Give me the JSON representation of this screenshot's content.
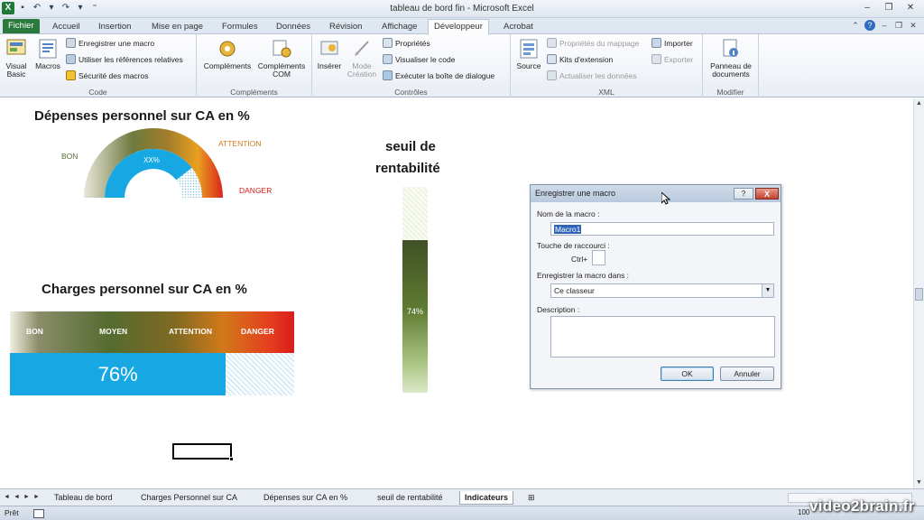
{
  "app": {
    "title": "tableau de bord fin  -  Microsoft Excel"
  },
  "ribbon_tabs": [
    {
      "label": "Fichier",
      "state": "file"
    },
    {
      "label": "Accueil",
      "state": ""
    },
    {
      "label": "Insertion",
      "state": ""
    },
    {
      "label": "Mise en page",
      "state": ""
    },
    {
      "label": "Formules",
      "state": ""
    },
    {
      "label": "Données",
      "state": ""
    },
    {
      "label": "Révision",
      "state": ""
    },
    {
      "label": "Affichage",
      "state": ""
    },
    {
      "label": "Développeur",
      "state": "active"
    },
    {
      "label": "Acrobat",
      "state": ""
    }
  ],
  "ribbon": {
    "code": {
      "group_label": "Code",
      "visual_basic": "Visual Basic",
      "macros": "Macros",
      "record_macro": "Enregistrer une macro",
      "relative_refs": "Utiliser les références relatives",
      "macro_security": "Sécurité des macros"
    },
    "addins": {
      "group_label": "Compléments",
      "addins": "Compléments",
      "com_addins": "Compléments COM"
    },
    "controls": {
      "group_label": "Contrôles",
      "insert": "Insérer",
      "design_mode": "Mode Création",
      "properties": "Propriétés",
      "view_code": "Visualiser le code",
      "run_dialog": "Exécuter la boîte de dialogue"
    },
    "xml": {
      "group_label": "XML",
      "source": "Source",
      "map_properties": "Propriétés du mappage",
      "expansion_packs": "Kits d'extension",
      "refresh_data": "Actualiser les données",
      "import": "Importer",
      "export": "Exporter"
    },
    "modify": {
      "group_label": "Modifier",
      "document_panel": "Panneau de documents"
    }
  },
  "gauge_semicircle": {
    "title": "Dépenses personnel sur CA en %",
    "value_label": "XX%",
    "labels": {
      "good": "BON",
      "attention": "ATTENTION",
      "danger": "DANGER"
    },
    "fill_fraction": 0.79
  },
  "gauge_horizontal": {
    "title": "Charges personnel sur CA en %",
    "labels": [
      "BON",
      "MOYEN",
      "ATTENTION",
      "DANGER"
    ],
    "value_label": "76%",
    "value": 0.76
  },
  "gauge_vertical": {
    "title_line1": "seuil de",
    "title_line2": "rentabilité",
    "value_label": "74%",
    "value": 0.74
  },
  "dialog": {
    "title": "Enregistrer une macro",
    "help_btn": "?",
    "close_btn": "X",
    "name_label": "Nom de la macro :",
    "name_value": "Macro1",
    "shortcut_label": "Touche de raccourci :",
    "ctrl_label": "Ctrl+",
    "store_label": "Enregistrer la macro dans :",
    "store_value": "Ce classeur",
    "desc_label": "Description :",
    "ok": "OK",
    "cancel": "Annuler"
  },
  "sheet_tabs": [
    {
      "label": "Tableau de bord",
      "active": false
    },
    {
      "label": "Charges Personnel sur CA",
      "active": false
    },
    {
      "label": "Dépenses sur CA en %",
      "active": false
    },
    {
      "label": "seuil de rentabilité",
      "active": false
    },
    {
      "label": "Indicateurs",
      "active": true
    }
  ],
  "status": {
    "ready": "Prêt",
    "zoom": "100"
  },
  "watermark": "video2brain.fr",
  "colors": {
    "excel_green": "#2a7a3e",
    "gauge_blue": "#17a8e3",
    "danger_red": "#d81c1c",
    "attention_orange": "#d2791a",
    "good_olive": "#556b2f"
  }
}
